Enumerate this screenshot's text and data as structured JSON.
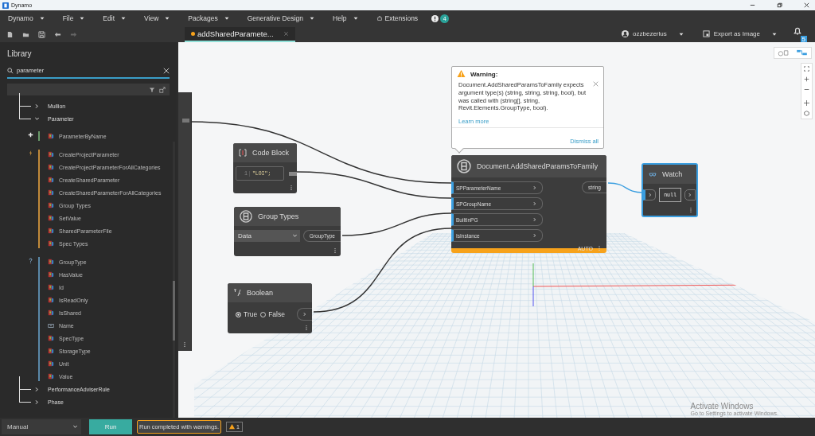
{
  "window": {
    "title": "Dynamo"
  },
  "menu": [
    {
      "label": "Dynamo",
      "dropdown": true
    },
    {
      "label": "File",
      "dropdown": true
    },
    {
      "label": "Edit",
      "dropdown": true
    },
    {
      "label": "View",
      "dropdown": true
    },
    {
      "label": "Packages",
      "dropdown": true
    },
    {
      "label": "Generative Design",
      "dropdown": true
    },
    {
      "label": "Help",
      "dropdown": true
    },
    {
      "label": "Extensions",
      "dropdown": false
    }
  ],
  "notifications": {
    "count": "4"
  },
  "toolbar": [
    {
      "kind": "new",
      "disabled": false
    },
    {
      "kind": "open",
      "disabled": false
    },
    {
      "kind": "save",
      "disabled": false
    },
    {
      "kind": "undo",
      "disabled": false
    },
    {
      "kind": "redo",
      "disabled": true
    }
  ],
  "tabs": [
    {
      "label": "addSharedParamete...",
      "selected": true,
      "modified": true
    }
  ],
  "user": {
    "name": "ozzbezerlus"
  },
  "export": {
    "label": "Export as Image"
  },
  "bell": {
    "count": "5"
  },
  "library": {
    "title": "Library",
    "search": {
      "value": "parameter"
    },
    "tree": [
      {
        "label": "Mullion",
        "expanded": false
      },
      {
        "label": "Parameter",
        "expanded": true,
        "groups": [
          {
            "kind": "create",
            "items": [
              {
                "label": "ParameterByName",
                "kind": "method"
              }
            ]
          },
          {
            "kind": "action",
            "items": [
              {
                "label": "CreateProjectParameter",
                "kind": "method"
              },
              {
                "label": "CreateProjectParameterForAllCategories",
                "kind": "method"
              },
              {
                "label": "CreateSharedParameter",
                "kind": "method"
              },
              {
                "label": "CreateSharedParameterForAllCategories",
                "kind": "method"
              },
              {
                "label": "Group Types",
                "kind": "method"
              },
              {
                "label": "SetValue",
                "kind": "method"
              },
              {
                "label": "SharedParameterFile",
                "kind": "method"
              },
              {
                "label": "Spec Types",
                "kind": "method"
              }
            ]
          },
          {
            "kind": "query",
            "items": [
              {
                "label": "GroupType",
                "kind": "method"
              },
              {
                "label": "HasValue",
                "kind": "method"
              },
              {
                "label": "Id",
                "kind": "method"
              },
              {
                "label": "IsReadOnly",
                "kind": "method"
              },
              {
                "label": "IsShared",
                "kind": "method"
              },
              {
                "label": "Name",
                "kind": "property"
              },
              {
                "label": "SpecType",
                "kind": "method"
              },
              {
                "label": "StorageType",
                "kind": "method"
              },
              {
                "label": "Unit",
                "kind": "method"
              },
              {
                "label": "Value",
                "kind": "method"
              }
            ]
          }
        ]
      },
      {
        "label": "PerformanceAdviserRule",
        "expanded": false
      },
      {
        "label": "Phase",
        "expanded": false
      }
    ]
  },
  "canvas_view": [
    {
      "kind": "geometry",
      "selected": false
    },
    {
      "kind": "graph",
      "selected": true
    }
  ],
  "warning": {
    "title": "Warning:",
    "message": "Document.AddSharedParamsToFamily expects argument type(s) (string, string, string, bool), but was called with (string[], string, Revit.Elements.GroupType, bool).",
    "link": "Learn more",
    "dismiss": "Dismiss all"
  },
  "nodes": [
    {
      "kind": "code_block",
      "title": "Code Block",
      "line": "1",
      "code": "\"LOI\";"
    },
    {
      "kind": "dropdown",
      "title": "Group Types",
      "value": "Data",
      "output": "GroupType"
    },
    {
      "kind": "boolean",
      "title": "Boolean",
      "options": [
        {
          "label": "True",
          "selected": true
        },
        {
          "label": "False",
          "selected": false
        }
      ]
    },
    {
      "kind": "function",
      "title": "Document.AddSharedParamsToFamily",
      "inputs": [
        "SPParameterName",
        "SPGroupName",
        "BuiltInPG",
        "IsInstance"
      ],
      "output": "string",
      "mode": "AUTO",
      "warning": true
    },
    {
      "kind": "watch",
      "title": "Watch",
      "value": "null",
      "selected": true
    }
  ],
  "activation": {
    "title": "Activate Windows",
    "subtitle": "Go to Settings to activate Windows."
  },
  "bottom": {
    "run_mode": "Manual",
    "run": "Run",
    "status": "Run completed with warnings.",
    "warnings": "1"
  }
}
